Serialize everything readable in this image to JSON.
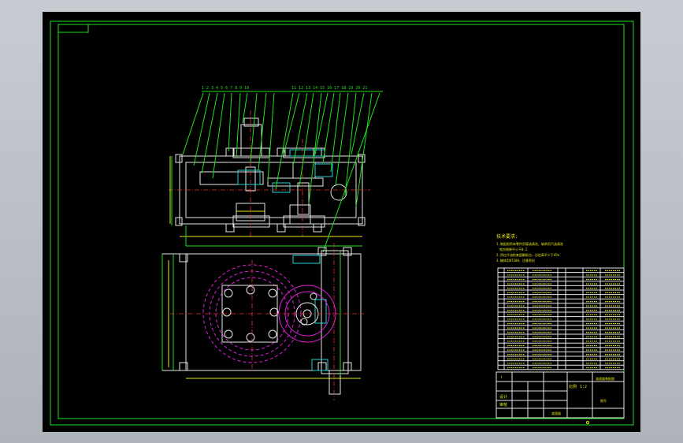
{
  "drawing": {
    "title_block": {
      "cells": [
        "Ⅰ",
        "设计",
        "审核",
        "比例",
        "1:2",
        "减速器装配图"
      ]
    },
    "colors": {
      "border": "#1fe21f",
      "parts": "#e6e6e6",
      "dimension": "#e8e81a",
      "center_line": "#e83030",
      "pitch_circle": "#e020e0",
      "hatch": "#1ed6d6"
    }
  }
}
